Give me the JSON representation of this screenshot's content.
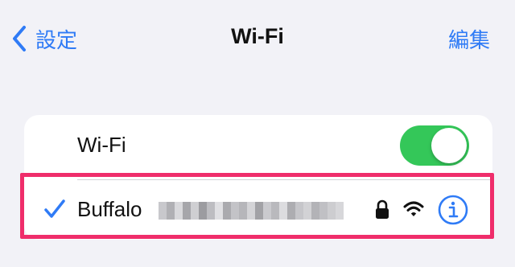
{
  "nav": {
    "back_label": "設定",
    "title": "Wi-Fi",
    "edit_label": "編集"
  },
  "wifi": {
    "label": "Wi-Fi",
    "enabled": true
  },
  "network": {
    "name": "Buffalo",
    "connected": true,
    "secured": true
  },
  "colors": {
    "accent": "#2f7bf6",
    "toggle_on": "#34c759",
    "highlight": "#ef2d6b"
  }
}
